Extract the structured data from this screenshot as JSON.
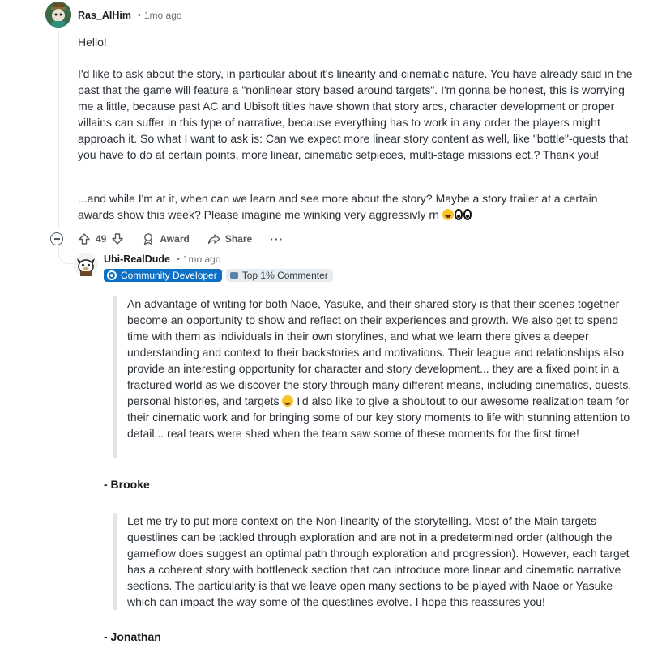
{
  "op_comment": {
    "author": "Ras_AlHim",
    "time": "1mo ago",
    "greeting": "Hello!",
    "paragraph_main": "I'd like to ask about the story, in particular about it's linearity and cinematic nature. You have already said in the past that the game will feature a \"nonlinear story based around targets\". I'm gonna be honest, this is worrying me a little, because past AC and Ubisoft titles have shown that story arcs, character development or proper villains can suffer in this type of narrative, because everything has to work in any order the players might approach it. So what I want to ask is: Can we expect more linear story content as well, like \"bottle\"-quests that you have to do at certain points, more linear, cinematic setpieces, multi-stage missions ect.? Thank you!",
    "paragraph_last": "...and while I'm at it, when can we learn and see more about the story? Maybe a story trailer at a certain awards show this week? Please imagine me winking very aggressivly rn",
    "emoji_names": [
      "laughing-emoji",
      "eyes-emoji"
    ]
  },
  "actions": {
    "vote_count": "49",
    "award_label": "Award",
    "share_label": "Share",
    "more_label": "···"
  },
  "reply": {
    "author": "Ubi-RealDude",
    "time": "1mo ago",
    "badge_developer": "Community Developer",
    "badge_top": "Top 1% Commenter",
    "colors": {
      "developer_badge": "#0b70c6",
      "top_badge_bg": "#e6ecf0"
    },
    "quote_1_part_a": "An advantage of writing for both Naoe, Yasuke, and their shared story is that their scenes together become an opportunity to show and reflect on their experiences and growth. We also get to spend time with them as individuals in their own storylines, and what we learn there gives a deeper understanding and context to their backstories and motivations. Their league and relationships also provide an interesting opportunity for character and story development... they are a fixed point in a fractured world as we discover the story through many different means, including cinematics, quests, personal histories, and targets",
    "quote_1_part_b": "I'd also like to give a shoutout to our awesome realization team for their cinematic work and for bringing some of our key story moments to life with stunning attention to detail... real tears were shed when the team saw some of these moments for the first time!",
    "signature_1": "- Brooke",
    "quote_2": "Let me try to put more context on the Non-linearity of the storytelling.  Most of the Main targets questlines can be tackled through exploration and are not in a predetermined order (although the gameflow does suggest an optimal path through exploration and progression).  However, each target has a coherent story with bottleneck section that can introduce more linear and cinematic narrative sections.  The particularity is that we leave open many sections to be played with Naoe or Yasuke which can impact the way some of the questlines evolve.  I hope this reassures you!",
    "signature_2": "- Jonathan"
  }
}
